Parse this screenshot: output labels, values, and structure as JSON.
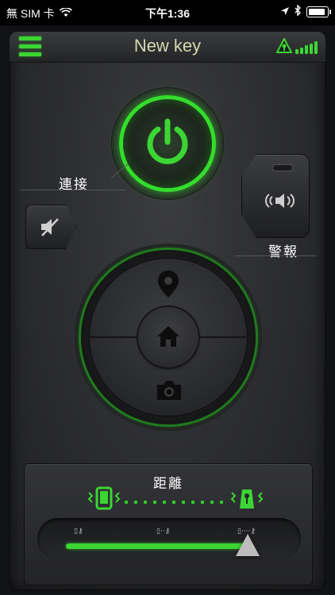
{
  "status_bar": {
    "carrier": "無 SIM 卡",
    "time": "下午1:36",
    "battery_level": 0.9,
    "icons": [
      "wifi-icon",
      "location-arrow-icon",
      "bluetooth-icon",
      "battery-icon"
    ]
  },
  "header": {
    "title": "New key",
    "signal_level": 5,
    "signal_max": 5
  },
  "controls": {
    "connect_label": "連接",
    "alarm_label": "警報"
  },
  "dial": {
    "icons": [
      "location-pin-icon",
      "home-icon",
      "camera-icon"
    ]
  },
  "distance": {
    "title": "距離",
    "ranges": [
      "▯⚷",
      "▯··⚷",
      "▯····⚷"
    ],
    "level": 0.88
  },
  "colors": {
    "accent": "#3bd633",
    "panel": "#2c2d30",
    "label": "#d8d8b0"
  }
}
